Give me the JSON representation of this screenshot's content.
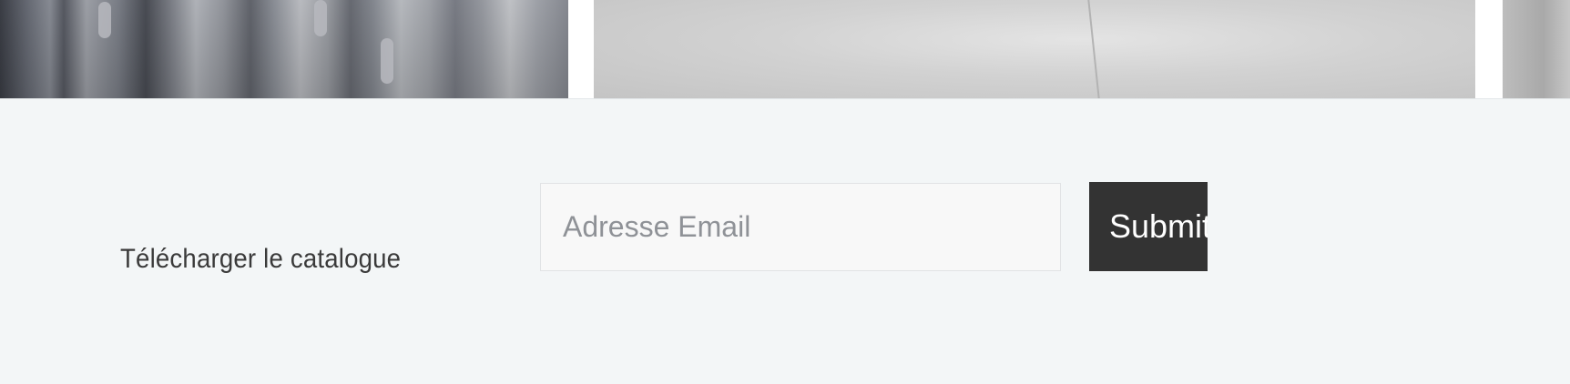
{
  "gallery": {
    "images": [
      {
        "icon": "mannequins-photo"
      },
      {
        "icon": "fabric-closeup-photo"
      },
      {
        "icon": "partial-photo"
      }
    ]
  },
  "newsletter": {
    "label": "Télécharger le catalogue",
    "email_placeholder": "Adresse Email",
    "email_value": "",
    "submit_label": "Submit"
  },
  "colors": {
    "background": "#f3f6f7",
    "button_bg": "#333333",
    "button_text": "#ffffff",
    "label_text": "#3a3a3a",
    "placeholder_text": "#8f9297"
  }
}
